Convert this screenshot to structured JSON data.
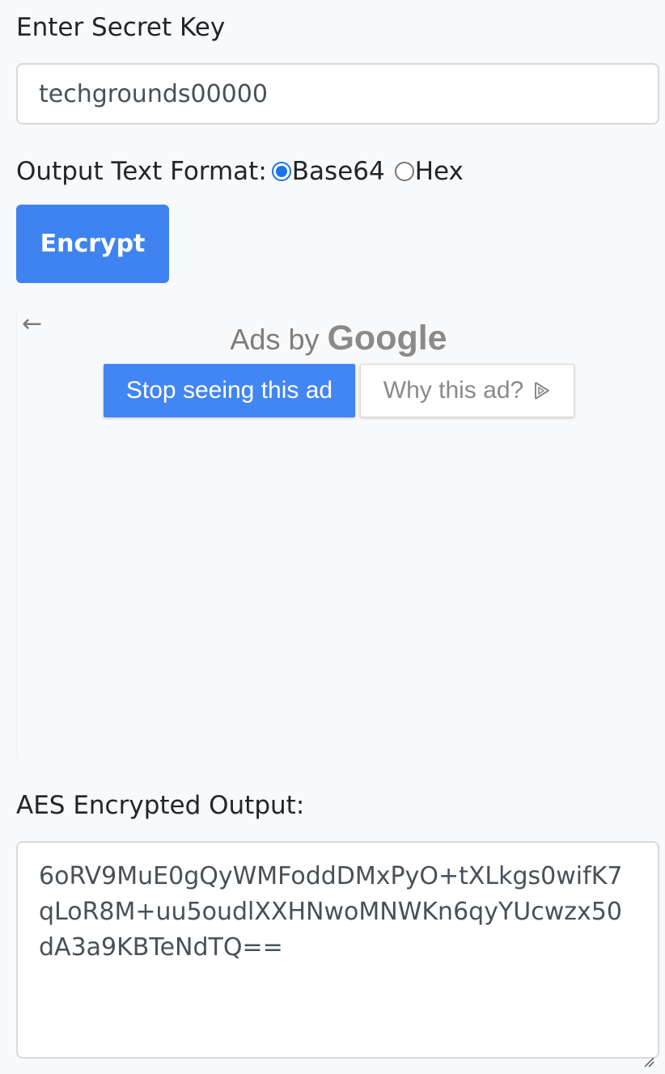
{
  "form": {
    "secret_key_label": "Enter Secret Key",
    "secret_key_value": "techgrounds00000",
    "output_format_label": "Output Text Format:",
    "format_options": [
      {
        "label": "Base64",
        "checked": true
      },
      {
        "label": "Hex",
        "checked": false
      }
    ],
    "encrypt_button": "Encrypt"
  },
  "ad": {
    "back_icon": "arrow-left-icon",
    "ads_by_text": "Ads by",
    "brand": "Google",
    "stop_button": "Stop seeing this ad",
    "why_button": "Why this ad?",
    "why_icon": "adchoices-play-icon"
  },
  "output": {
    "label": "AES Encrypted Output:",
    "value": "6oRV9MuE0gQyWMFoddDMxPyO+tXLkgs0wifK7qLoR8M+uu5oudlXXHNwoMNWKn6qyYUcwzx50dA3a9KBTeNdTQ=="
  },
  "colors": {
    "accent": "#3e83f0",
    "ad_button": "#4285f4",
    "radio_checked": "#1a73e8",
    "background": "#f8f9fa"
  }
}
